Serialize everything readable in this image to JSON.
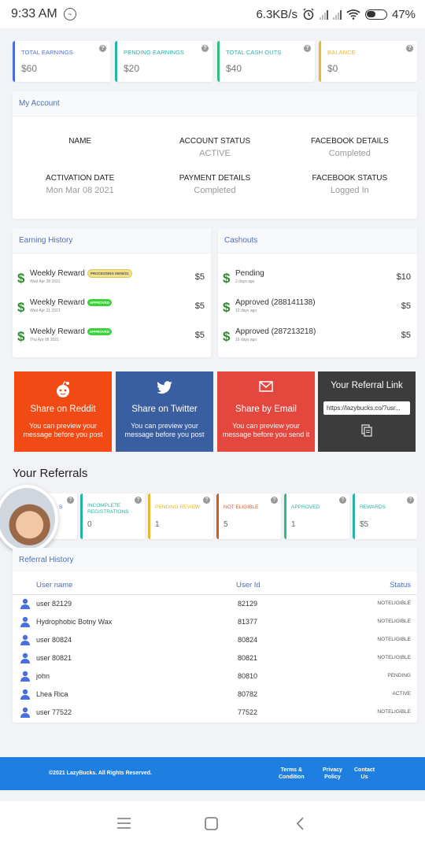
{
  "status_bar": {
    "time": "9:33 AM",
    "speed": "6.3KB/s",
    "battery": "47%"
  },
  "stats": [
    {
      "label": "TOTAL EARNINGS",
      "value": "$60",
      "color": "#4a6ee0"
    },
    {
      "label": "PENDING EARNINGS",
      "value": "$20",
      "color": "#26b3a8"
    },
    {
      "label": "TOTAL CASH OUTS",
      "value": "$40",
      "color": "#2fbf7a"
    },
    {
      "label": "BALANCE",
      "value": "$0",
      "color": "#e8b830"
    }
  ],
  "my_account": {
    "title": "My Account",
    "fields": [
      {
        "key": "NAME",
        "value": ""
      },
      {
        "key": "ACCOUNT STATUS",
        "value": "ACTIVE"
      },
      {
        "key": "FACEBOOK DETAILS",
        "value": "Completed"
      },
      {
        "key": "ACTIVATION DATE",
        "value": "Mon Mar 08 2021"
      },
      {
        "key": "PAYMENT DETAILS",
        "value": "Completed"
      },
      {
        "key": "FACEBOOK STATUS",
        "value": "Logged In"
      }
    ]
  },
  "earning_history": {
    "title": "Earning History",
    "items": [
      {
        "title": "Weekly Reward",
        "date": "Wed Apr 28 2021",
        "badge": "PROCESSING 05/05/21",
        "badge_color": "#f0e08a",
        "amount": "$5"
      },
      {
        "title": "Weekly Reward",
        "date": "Wed Apr 21 2021",
        "badge": "APPROVED",
        "badge_color": "#3ad33a",
        "amount": "$5"
      },
      {
        "title": "Weekly Reward",
        "date": "Thu Apr 08 2021",
        "badge": "APPROVED",
        "badge_color": "#3ad33a",
        "amount": "$5"
      }
    ]
  },
  "cashouts": {
    "title": "Cashouts",
    "items": [
      {
        "title": "Pending",
        "date": "2 days ago",
        "amount": "$10"
      },
      {
        "title": "Approved (288141138)",
        "date": "12 days ago",
        "amount": "$5"
      },
      {
        "title": "Approved (287213218)",
        "date": "16 days ago",
        "amount": "$5"
      }
    ]
  },
  "share": [
    {
      "title": "Share on Reddit",
      "desc": "You can preview your message before you post",
      "color": "#f24a14"
    },
    {
      "title": "Share on Twitter",
      "desc": "You can preview your message before you post",
      "color": "#3a5fa0"
    },
    {
      "title": "Share by Email",
      "desc": "You can preview your message before you send it",
      "color": "#e4473d"
    },
    {
      "title": "Your Referral Link",
      "link": "https://lazybucks.co/?usr...",
      "color": "#3c3c3c"
    }
  ],
  "referrals": {
    "title": "Your Referrals",
    "stats": [
      {
        "label": "S",
        "value": "",
        "color": "#4a6ee0"
      },
      {
        "label": "INCOMPLETE REGISTRATIONS",
        "value": "0",
        "color": "#26b3a8"
      },
      {
        "label": "PENDING REVIEW",
        "value": "1",
        "color": "#e8b830"
      },
      {
        "label": "NOT ELIGIBLE",
        "value": "5",
        "color": "#d9562b"
      },
      {
        "label": "APPROVED",
        "value": "1",
        "color": "#2fbf7a"
      },
      {
        "label": "REWARDS",
        "value": "$5",
        "color": "#26b3a8"
      }
    ]
  },
  "referral_history": {
    "title": "Referral History",
    "headers": {
      "user": "User name",
      "id": "User Id",
      "status": "Status"
    },
    "rows": [
      {
        "user": "user 82129",
        "id": "82129",
        "status": "NOTELIGIBLE"
      },
      {
        "user": "Hydrophobic Botny Wax",
        "id": "81377",
        "status": "NOTELIGIBLE"
      },
      {
        "user": "user 80824",
        "id": "80824",
        "status": "NOTELIGIBLE"
      },
      {
        "user": "user 80821",
        "id": "80821",
        "status": "NOTELIGIBLE"
      },
      {
        "user": "john",
        "id": "80810",
        "status": "PENDING"
      },
      {
        "user": "Lhea Rica",
        "id": "80782",
        "status": "ACTIVE"
      },
      {
        "user": "user 77522",
        "id": "77522",
        "status": "NOTELIGIBLE"
      }
    ]
  },
  "footer": {
    "copyright": "©2021 LazyBucks. All Rights Reserved.",
    "terms_line1": "Terms &",
    "terms_line2": "Condition",
    "privacy_line1": "Privacy",
    "privacy_line2": "Policy",
    "contact_line1": "Contact",
    "contact_line2": "Us"
  }
}
